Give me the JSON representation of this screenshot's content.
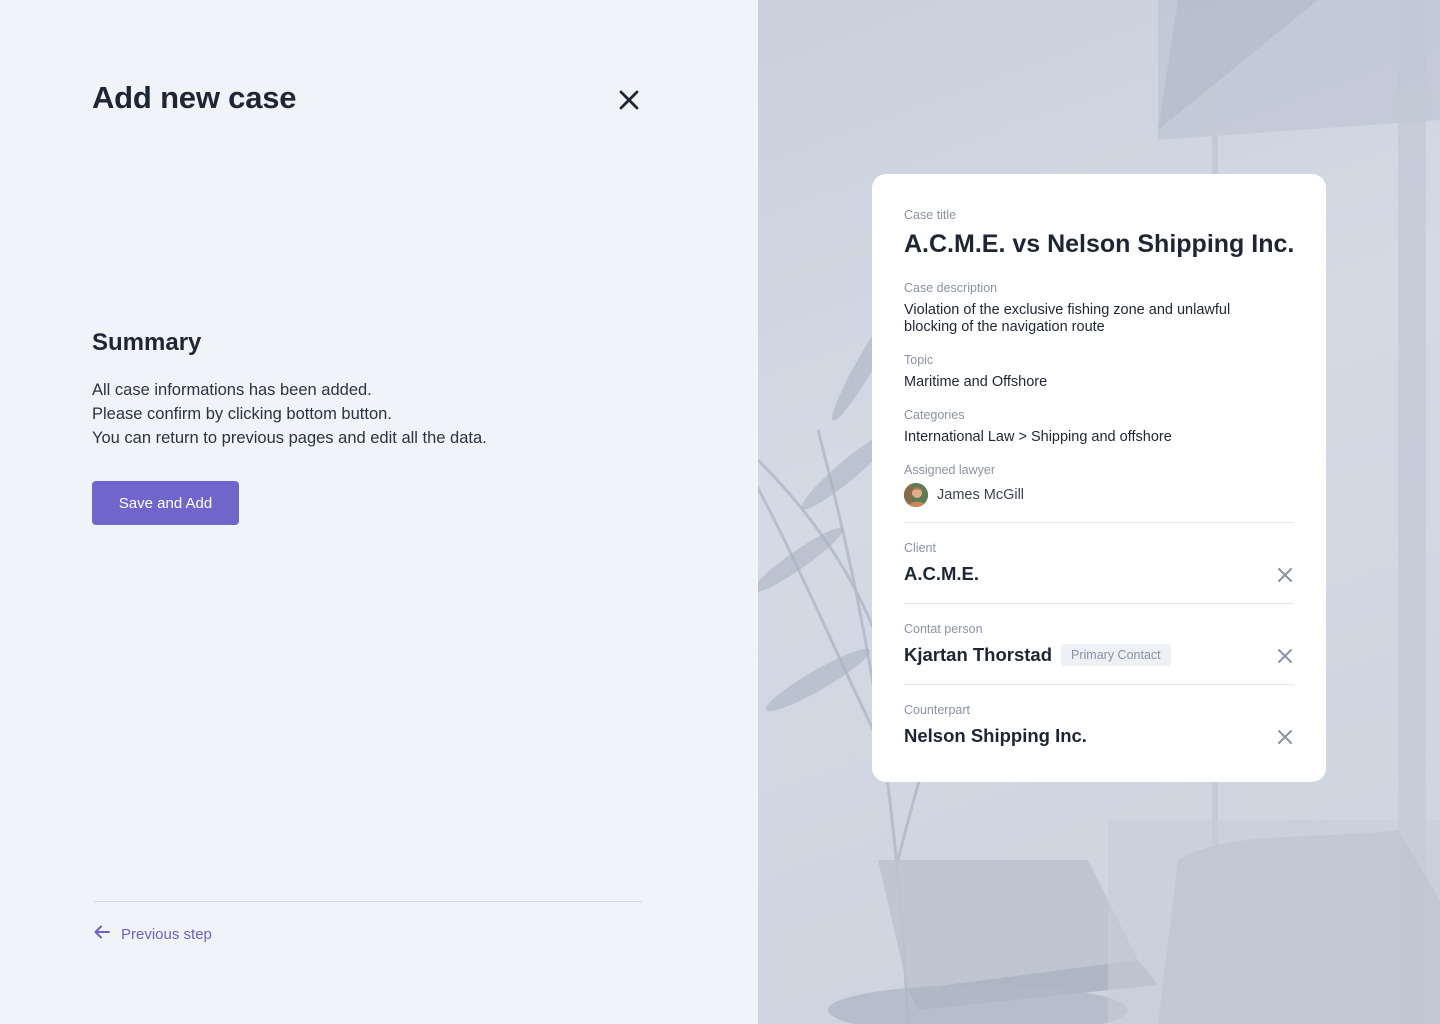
{
  "header": {
    "title": "Add new case"
  },
  "summary": {
    "title": "Summary",
    "lines": [
      "All case informations has been added.",
      "Please confirm by clicking bottom button.",
      "You can return to previous pages and edit all the data."
    ],
    "save_label": "Save and Add"
  },
  "footer": {
    "prev_label": "Previous step"
  },
  "card": {
    "case_title_label": "Case title",
    "case_title": "A.C.M.E. vs Nelson Shipping Inc.",
    "description_label": "Case description",
    "description": "Violation of the exclusive fishing zone and unlawful blocking of the navigation route",
    "topic_label": "Topic",
    "topic": "Maritime and Offshore",
    "categories_label": "Categories",
    "categories": "International Law > Shipping and offshore",
    "lawyer_label": "Assigned lawyer",
    "lawyer": "James McGill",
    "client_label": "Client",
    "client": "A.C.M.E.",
    "contact_label": "Contat person",
    "contact": "Kjartan Thorstad",
    "contact_badge": "Primary Contact",
    "counterpart_label": "Counterpart",
    "counterpart": "Nelson Shipping Inc."
  },
  "colors": {
    "accent": "#6f66cc",
    "background": "#f0f3f8",
    "text_primary": "#1f2633",
    "text_muted": "#8a93a3"
  },
  "icons": {
    "close": "close-icon",
    "back": "arrow-left-icon"
  }
}
